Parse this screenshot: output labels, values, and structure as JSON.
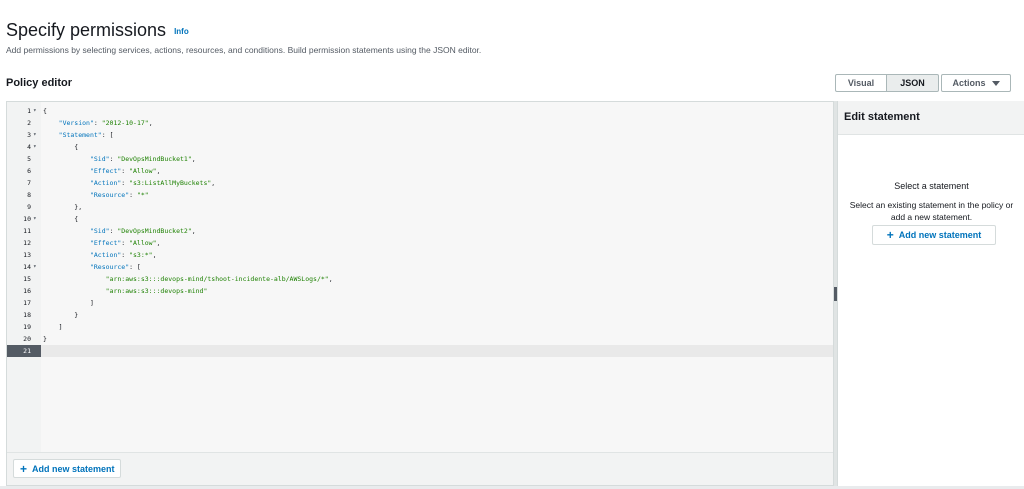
{
  "header": {
    "title": "Specify permissions",
    "info": "Info",
    "subtitle": "Add permissions by selecting services, actions, resources, and conditions. Build permission statements using the JSON editor."
  },
  "editor": {
    "label": "Policy editor",
    "tabs": [
      "Visual",
      "JSON"
    ],
    "selected_tab": "JSON",
    "actions_label": "Actions",
    "code_lines": [
      {
        "n": "1",
        "fold": true,
        "html": "{"
      },
      {
        "n": "2",
        "fold": false,
        "html": "    <span class=\"k\">\"Version\"</span>: <span class=\"s\">\"2012-10-17\"</span>,"
      },
      {
        "n": "3",
        "fold": true,
        "html": "    <span class=\"k\">\"Statement\"</span>: ["
      },
      {
        "n": "4",
        "fold": true,
        "html": "        {"
      },
      {
        "n": "5",
        "fold": false,
        "html": "            <span class=\"k\">\"Sid\"</span>: <span class=\"s\">\"DevOpsMindBucket1\"</span>,"
      },
      {
        "n": "6",
        "fold": false,
        "html": "            <span class=\"k\">\"Effect\"</span>: <span class=\"s\">\"Allow\"</span>,"
      },
      {
        "n": "7",
        "fold": false,
        "html": "            <span class=\"k\">\"Action\"</span>: <span class=\"s\">\"s3:ListAllMyBuckets\"</span>,"
      },
      {
        "n": "8",
        "fold": false,
        "html": "            <span class=\"k\">\"Resource\"</span>: <span class=\"s\">\"*\"</span>"
      },
      {
        "n": "9",
        "fold": false,
        "html": "        },"
      },
      {
        "n": "10",
        "fold": true,
        "html": "        {"
      },
      {
        "n": "11",
        "fold": false,
        "html": "            <span class=\"k\">\"Sid\"</span>: <span class=\"s\">\"DevOpsMindBucket2\"</span>,"
      },
      {
        "n": "12",
        "fold": false,
        "html": "            <span class=\"k\">\"Effect\"</span>: <span class=\"s\">\"Allow\"</span>,"
      },
      {
        "n": "13",
        "fold": false,
        "html": "            <span class=\"k\">\"Action\"</span>: <span class=\"s\">\"s3:*\"</span>,"
      },
      {
        "n": "14",
        "fold": true,
        "html": "            <span class=\"k\">\"Resource\"</span>: ["
      },
      {
        "n": "15",
        "fold": false,
        "html": "                <span class=\"s\">\"arn:aws:s3:::devops-mind/tshoot-incidente-alb/AWSLogs/*\"</span>,"
      },
      {
        "n": "16",
        "fold": false,
        "html": "                <span class=\"s\">\"arn:aws:s3:::devops-mind\"</span>"
      },
      {
        "n": "17",
        "fold": false,
        "html": "            ]"
      },
      {
        "n": "18",
        "fold": false,
        "html": "        }"
      },
      {
        "n": "19",
        "fold": false,
        "html": "    ]"
      },
      {
        "n": "20",
        "fold": false,
        "html": "}"
      },
      {
        "n": "21",
        "fold": false,
        "html": "",
        "active": true
      }
    ],
    "add_statement_label": "Add new statement"
  },
  "side_panel": {
    "title": "Edit statement",
    "select_title": "Select a statement",
    "select_desc": "Select an existing statement in the policy or add a new statement.",
    "add_statement_label": "Add new statement"
  },
  "icons": {
    "plus": "plus-icon",
    "caret": "caret-down-icon",
    "fold": "fold-toggle-icon"
  },
  "colors": {
    "link": "#0073bb",
    "json_key": "#0073bb",
    "json_string": "#1d8102"
  }
}
